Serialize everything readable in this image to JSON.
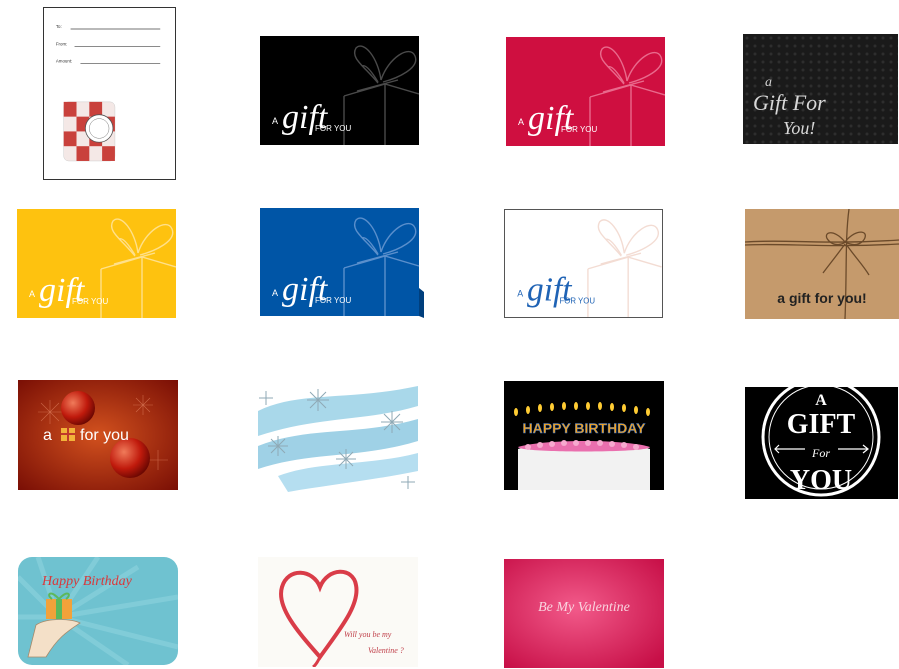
{
  "gift_form": {
    "to_label": "To:",
    "from_label": "From:",
    "amount_label": "Amount:"
  },
  "generic_card": {
    "a_text": "A",
    "gift_text": "gift",
    "for_you_text": "FOR YOU"
  },
  "script_card": {
    "text_line1": "a",
    "text_line2": "Gift For",
    "text_line3": "You!"
  },
  "kraft_card": {
    "text": "a gift for you!"
  },
  "christmas_card": {
    "text_before": "a",
    "text_after": "for you"
  },
  "birthday_candles_card": {
    "text": "HAPPY BIRTHDAY"
  },
  "badge_card": {
    "text_a": "A",
    "text_gift": "GIFT",
    "text_for": "For",
    "text_you": "YOU"
  },
  "birthday_hand_card": {
    "text": "Happy Birthday"
  },
  "valentine_ribbon_card": {
    "line1": "Will you be my",
    "line2": "Valentine ?"
  },
  "valentine_pink_card": {
    "text": "Be My Valentine"
  },
  "colors": {
    "black": "#000000",
    "red": "#cf0f40",
    "yellow": "#fec20f",
    "blue": "#0055a6",
    "kraft": "#c59a6c",
    "christmas": "#a3200d",
    "valentine_pink": "#e5185a",
    "teal": "#6fc2d0"
  }
}
